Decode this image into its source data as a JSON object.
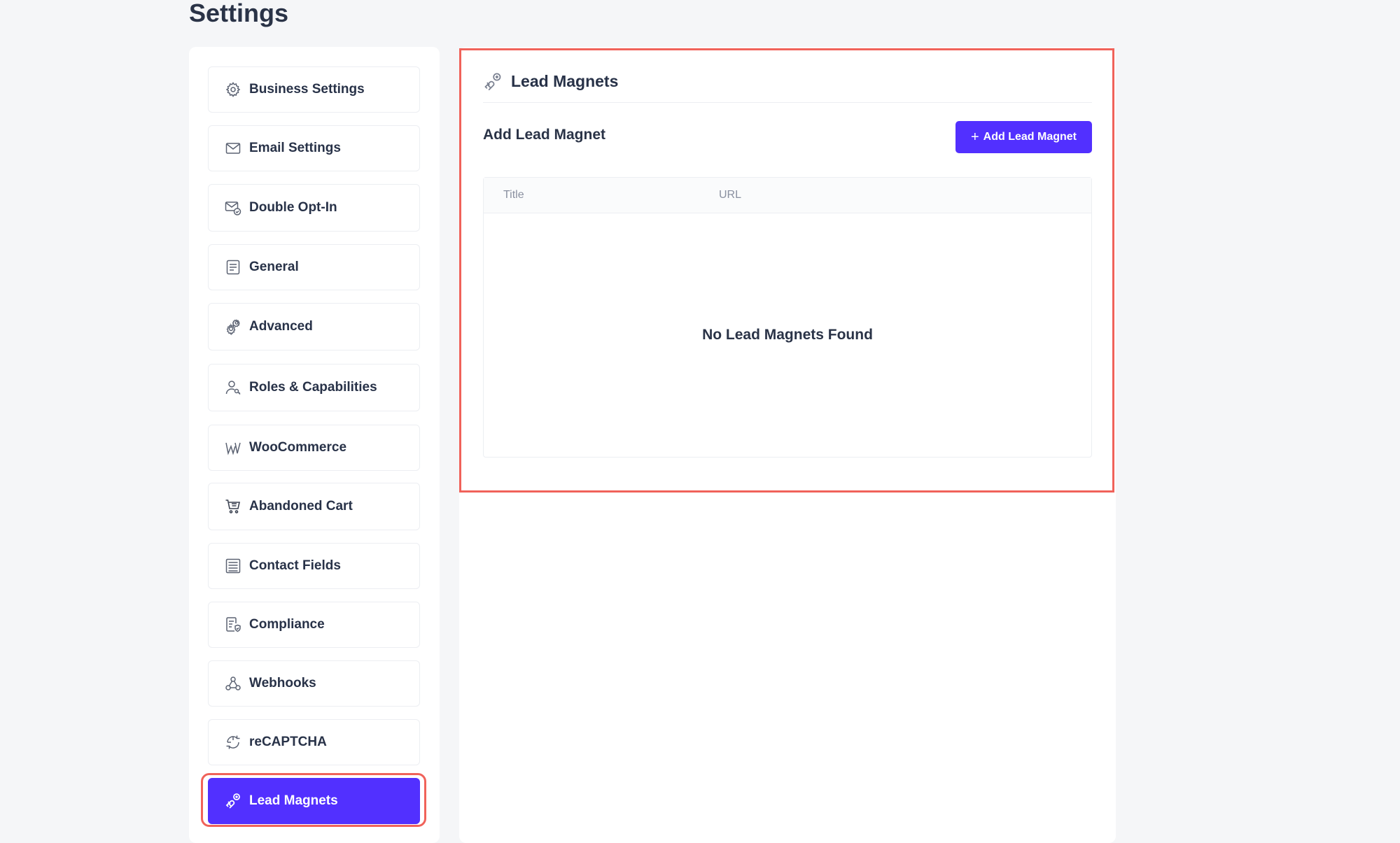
{
  "page": {
    "title": "Settings"
  },
  "sidebar": {
    "items": [
      {
        "label": "Business Settings",
        "icon": "gear-icon"
      },
      {
        "label": "Email Settings",
        "icon": "envelope-icon"
      },
      {
        "label": "Double Opt-In",
        "icon": "envelope-check-icon"
      },
      {
        "label": "General",
        "icon": "document-icon"
      },
      {
        "label": "Advanced",
        "icon": "gears-icon"
      },
      {
        "label": "Roles & Capabilities",
        "icon": "user-key-icon"
      },
      {
        "label": "WooCommerce",
        "icon": "woocommerce-icon"
      },
      {
        "label": "Abandoned Cart",
        "icon": "cart-icon"
      },
      {
        "label": "Contact Fields",
        "icon": "form-fields-icon"
      },
      {
        "label": "Compliance",
        "icon": "document-shield-icon"
      },
      {
        "label": "Webhooks",
        "icon": "webhook-icon"
      },
      {
        "label": "reCAPTCHA",
        "icon": "recaptcha-icon"
      },
      {
        "label": "Lead Magnets",
        "icon": "magnet-icon",
        "active": true
      }
    ]
  },
  "main": {
    "header_title": "Lead Magnets",
    "section_title": "Add Lead Magnet",
    "add_button_label": "Add Lead Magnet",
    "table": {
      "columns": [
        "Title",
        "URL"
      ],
      "empty_text": "No Lead Magnets Found"
    }
  },
  "colors": {
    "accent": "#5230ff",
    "highlight": "#f0625a",
    "background": "#f5f6f8"
  }
}
